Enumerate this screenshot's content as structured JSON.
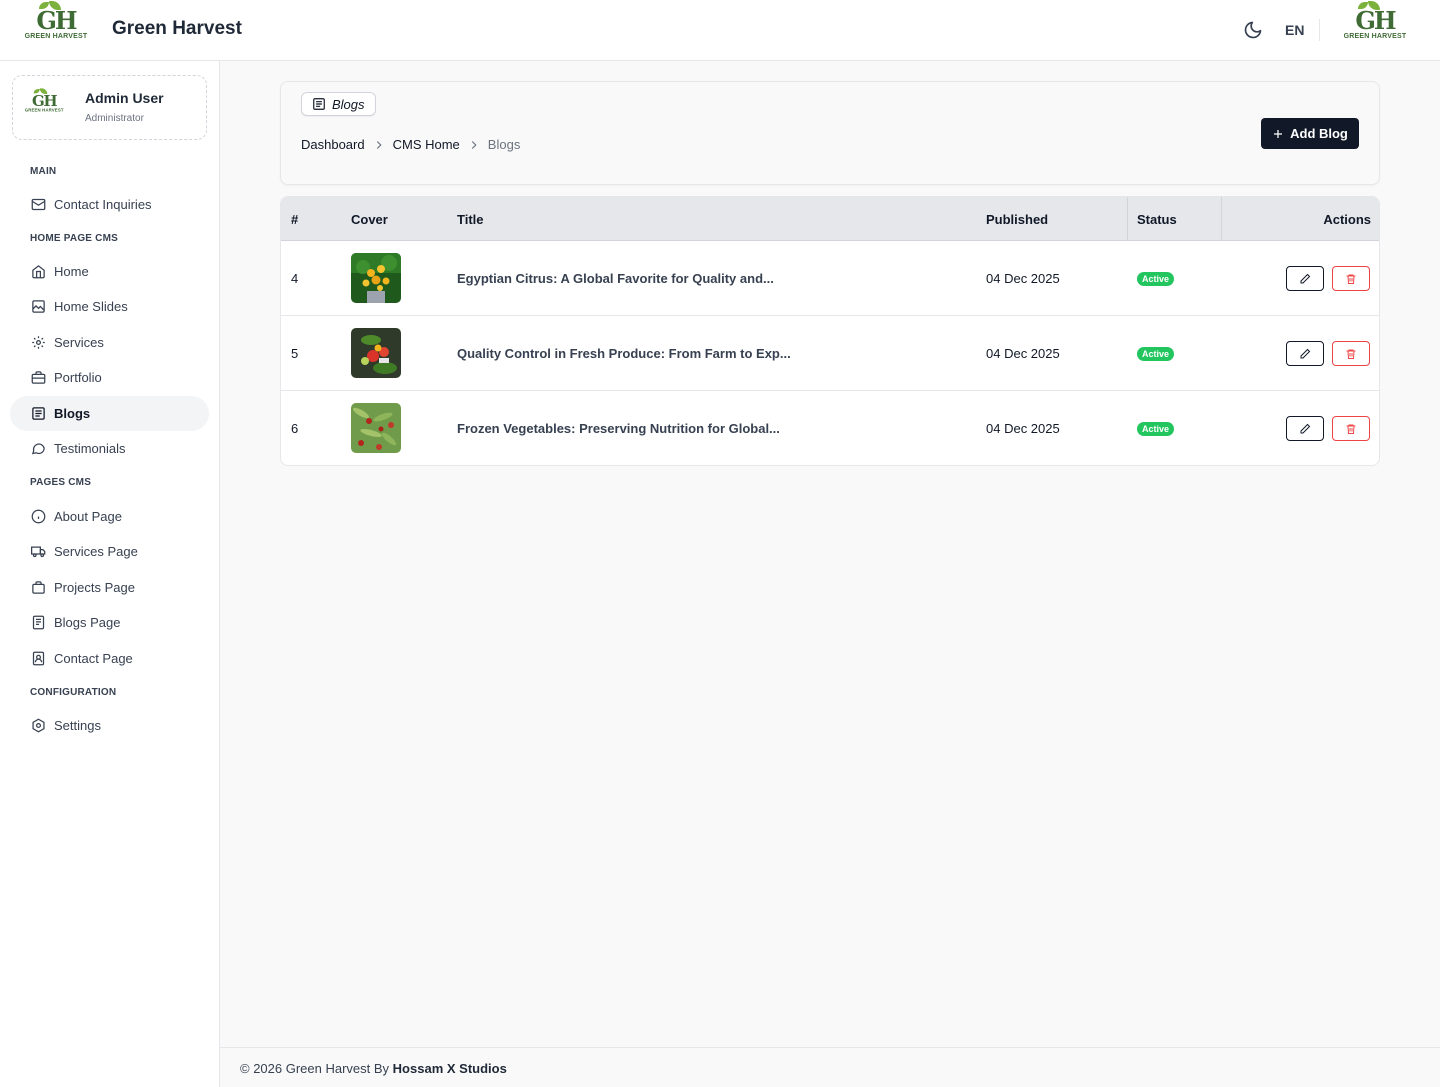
{
  "header": {
    "logo_caption": "GREEN HARVEST",
    "logo_mark": "GH",
    "brand": "Green Harvest",
    "language": "EN"
  },
  "sidebar": {
    "user": {
      "name": "Admin User",
      "role": "Administrator"
    },
    "sections": {
      "main": "MAIN",
      "home_cms": "HOME PAGE CMS",
      "pages_cms": "PAGES CMS",
      "configuration": "CONFIGURATION"
    },
    "items": {
      "contact_inquiries": "Contact Inquiries",
      "home": "Home",
      "home_slides": "Home Slides",
      "services": "Services",
      "portfolio": "Portfolio",
      "blogs": "Blogs",
      "testimonials": "Testimonials",
      "about_page": "About Page",
      "services_page": "Services Page",
      "projects_page": "Projects Page",
      "blogs_page": "Blogs Page",
      "contact_page": "Contact Page",
      "settings": "Settings"
    }
  },
  "page": {
    "pill": "Blogs",
    "breadcrumbs": [
      "Dashboard",
      "CMS Home",
      "Blogs"
    ],
    "add_button": "Add Blog"
  },
  "table": {
    "columns": [
      "#",
      "Cover",
      "Title",
      "Published",
      "Status",
      "Actions"
    ],
    "rows": [
      {
        "id": "4",
        "title": "Egyptian Citrus: A Global Favorite for Quality and...",
        "published": "04 Dec 2025",
        "status": "Active"
      },
      {
        "id": "5",
        "title": "Quality Control in Fresh Produce: From Farm to Exp...",
        "published": "04 Dec 2025",
        "status": "Active"
      },
      {
        "id": "6",
        "title": "Frozen Vegetables: Preserving Nutrition for Global...",
        "published": "04 Dec 2025",
        "status": "Active"
      }
    ]
  },
  "footer": {
    "prefix": "© 2026 Green Harvest By",
    "author": "Hossam X Studios"
  },
  "colors": {
    "accent_dark": "#111827",
    "status_active": "#22c55e",
    "danger": "#ef4444",
    "logo_green": "#3f6b34"
  }
}
